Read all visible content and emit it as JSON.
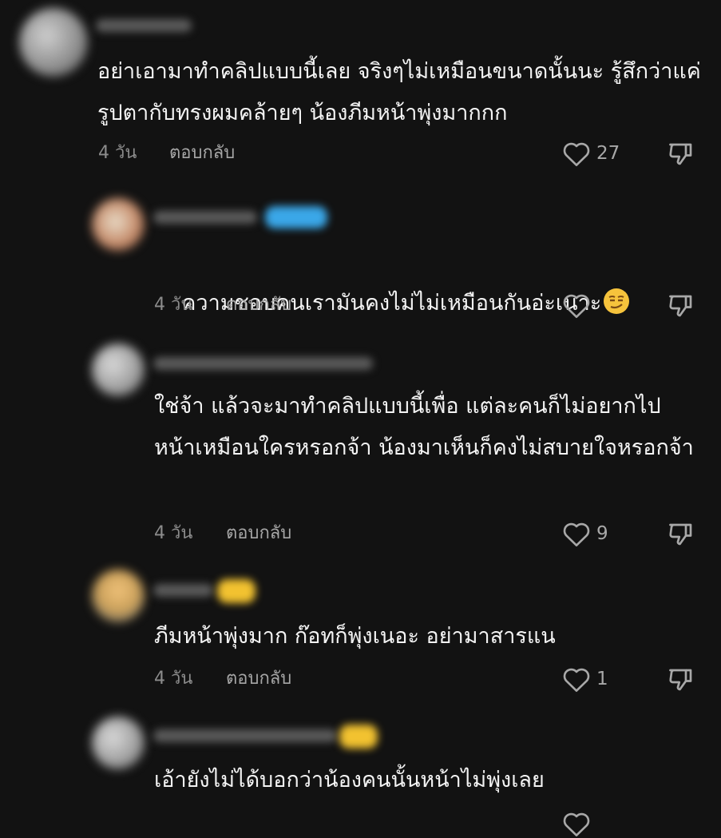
{
  "comments": [
    {
      "text": "อย่าเอามาทำคลิปแบบนี้เลย จริงๆไม่เหมือนขนาดนั้นนะ รู้สึกว่าแค่รูปตากับทรงผมคล้ายๆ น้องภีมหน้าพุ่งมากกก",
      "time": "4 วัน",
      "reply_label": "ตอบกลับ",
      "likes": "27"
    },
    {
      "text": "ความชอบคนเรามันคงไม่ไม่เหมือนกันอ่ะเนาะ",
      "time": "4 วัน",
      "reply_label": "ตอบกลับ",
      "likes": "",
      "emoji": "smirking-face-emoji"
    },
    {
      "text": "ใช่จ้า แล้วจะมาทำคลิปแบบนี้เพื่อ แต่ละคนก็ไม่อยากไปหน้าเหมือนใครหรอกจ้า น้องมาเห็นก็คงไม่สบายใจหรอกจ้า",
      "time": "4 วัน",
      "reply_label": "ตอบกลับ",
      "likes": "9"
    },
    {
      "text": "ภีมหน้าพุ่งมาก ก๊อทก็พุ่งเนอะ อย่ามาสารแน",
      "time": "4 วัน",
      "reply_label": "ตอบกลับ",
      "likes": "1"
    },
    {
      "text": "เอ้ายังไม่ได้บอกว่าน้องคนนั้นหน้าไม่พุ่งเลย",
      "time": "",
      "reply_label": "",
      "likes": ""
    }
  ],
  "icons": {
    "like": "heart-outline-icon",
    "dislike": "thumbs-down-outline-icon"
  },
  "colors": {
    "background": "#121212",
    "text": "#f3f3f3",
    "meta": "#8c8c8c"
  }
}
